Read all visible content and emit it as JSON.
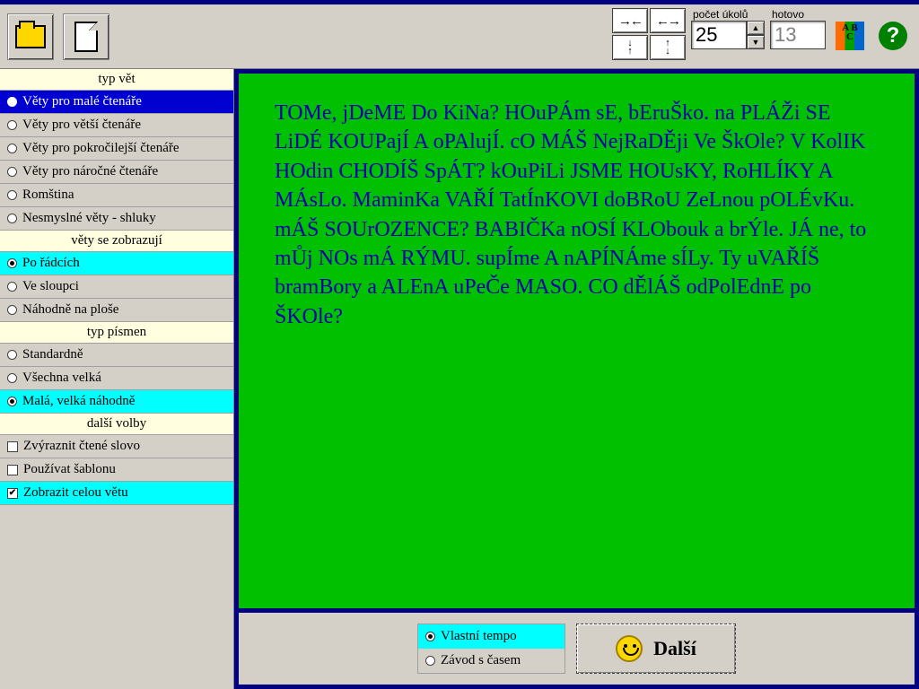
{
  "toolbar": {
    "tasks_label": "počet úkolů",
    "done_label": "hotovo",
    "tasks_value": "25",
    "done_value": "13"
  },
  "groups": {
    "sentence_type": {
      "header": "typ vět",
      "options": [
        "Věty pro malé čtenáře",
        "Věty pro větší čtenáře",
        "Věty pro pokročilejší čtenáře",
        "Věty pro náročné čtenáře",
        "Romština",
        "Nesmyslné věty - shluky"
      ],
      "selected": 0
    },
    "display_mode": {
      "header": "věty se zobrazují",
      "options": [
        "Po řádcích",
        "Ve sloupci",
        "Náhodně na ploše"
      ],
      "selected": 0
    },
    "letter_type": {
      "header": "typ písmen",
      "options": [
        "Standardně",
        "Všechna velká",
        "Malá, velká náhodně"
      ],
      "selected": 2
    },
    "other": {
      "header": "další volby",
      "options": [
        "Zvýraznit čtené slovo",
        "Používat šablonu",
        "Zobrazit celou větu"
      ],
      "checked": [
        false,
        false,
        true
      ]
    }
  },
  "main_text": "TOMe, jDeME Do KiNa? HOuPÁm sE, bEruŠko. na PLÁŽi SE LiDÉ KOUPajÍ A oPAlujÍ. cO MÁŠ NejRaDĚji Ve ŠkOle? V KolIK HOdin CHODÍŠ SpÁT? kOuPiLi JSME HOUsKY, RoHLÍKY A MÁsLo. MaminKa VAŘÍ TatÍnKOVI doBRoU ZeLnou pOLÉvKu. mÁŠ SOUrOZENCE? BABIČKa nOSÍ KLObouk a brÝle. JÁ ne, to mŮj NOs mÁ RÝMU. supÍme A nAPÍNÁme sÍLy. Ty uVAŘÍŠ bramBory a ALEnA uPeČe MASO. CO dĚlÁŠ odPolEdnE po ŠKOle?",
  "tempo": {
    "options": [
      "Vlastní tempo",
      "Závod s časem"
    ],
    "selected": 0
  },
  "next_label": "Další"
}
